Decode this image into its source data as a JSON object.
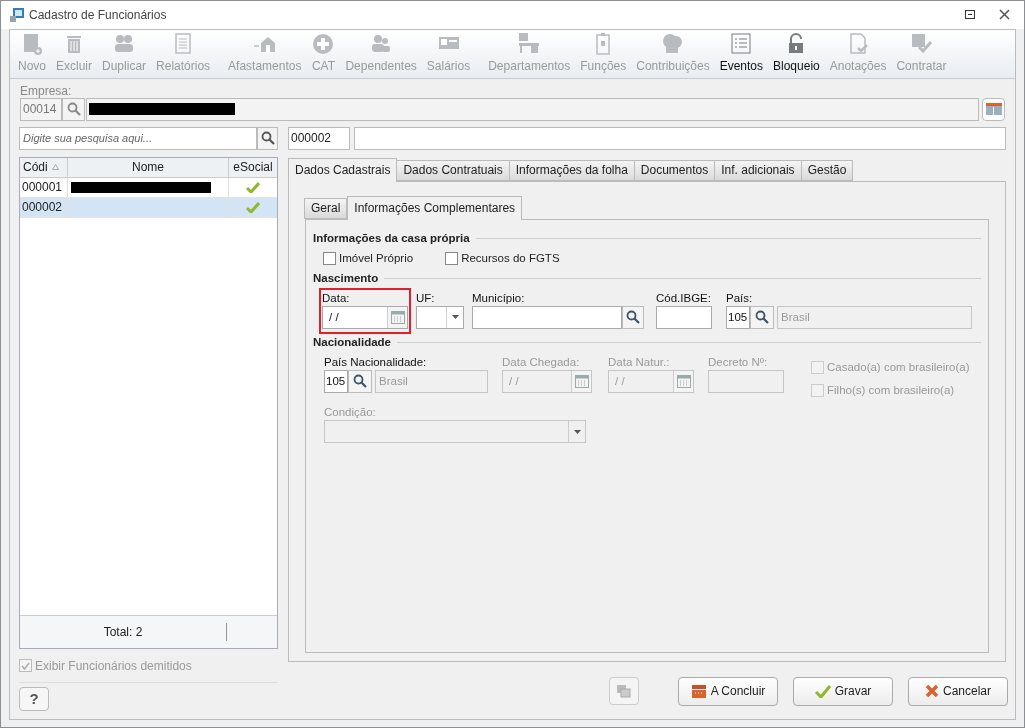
{
  "window": {
    "title": "Cadastro de Funcionários"
  },
  "toolbar": [
    {
      "label": "Novo",
      "disabled": true
    },
    {
      "label": "Excluir",
      "disabled": true
    },
    {
      "label": "Duplicar",
      "disabled": true
    },
    {
      "label": "Relatórios",
      "disabled": true
    },
    {
      "label": "Afastamentos",
      "disabled": true
    },
    {
      "label": "CAT",
      "disabled": true
    },
    {
      "label": "Dependentes",
      "disabled": true
    },
    {
      "label": "Salários",
      "disabled": true
    },
    {
      "label": "Departamentos",
      "disabled": true
    },
    {
      "label": "Funções",
      "disabled": true
    },
    {
      "label": "Contribuições",
      "disabled": true
    },
    {
      "label": "Eventos",
      "disabled": false
    },
    {
      "label": "Bloqueio",
      "disabled": false
    },
    {
      "label": "Anotações",
      "disabled": true
    },
    {
      "label": "Contratar",
      "disabled": true
    }
  ],
  "empresa": {
    "label": "Empresa:",
    "code": "00014",
    "name_redacted": true
  },
  "search": {
    "placeholder": "Digite sua pesquisa aqui..."
  },
  "grid": {
    "columns": [
      "Códi",
      "Nome",
      "eSocial"
    ],
    "rows": [
      {
        "code": "000001",
        "name_redacted": true,
        "esocial": true,
        "selected": false
      },
      {
        "code": "000002",
        "name_redacted": false,
        "esocial": true,
        "selected": true
      }
    ],
    "total": "Total: 2"
  },
  "show_dismissed": {
    "label": "Exibir Funcionários demitidos",
    "checked": true,
    "disabled": true
  },
  "help_button": "?",
  "record": {
    "code": "000002"
  },
  "tabs": [
    {
      "label": "Dados Cadastrais",
      "selected": true
    },
    {
      "label": "Dados Contratuais",
      "selected": false
    },
    {
      "label": "Informações da folha",
      "selected": false
    },
    {
      "label": "Documentos",
      "selected": false
    },
    {
      "label": "Inf. adicionais",
      "selected": false
    },
    {
      "label": "Gestão",
      "selected": false
    }
  ],
  "subtabs": [
    {
      "label": "Geral",
      "selected": false
    },
    {
      "label": "Informações Complementares",
      "selected": true
    }
  ],
  "casa_propria": {
    "title": "Informações da casa própria",
    "checkboxes": [
      {
        "label": "Imóvel Próprio",
        "checked": false
      },
      {
        "label": "Recursos do FGTS",
        "checked": false
      }
    ]
  },
  "nascimento": {
    "title": "Nascimento",
    "fields": [
      {
        "kind": "date",
        "label": "Data:",
        "value": "/ /",
        "disabled": false,
        "highlighted": true
      },
      {
        "kind": "select",
        "label": "UF:",
        "disabled": false,
        "highlighted": false
      },
      {
        "kind": "lookup",
        "label": "Município:",
        "disabled": false,
        "highlighted": false
      },
      {
        "kind": "text",
        "label": "Cód.IBGE:",
        "disabled": false,
        "highlighted": false
      },
      {
        "kind": "code_lookup",
        "label": "País:",
        "value": "105",
        "description": "Brasil",
        "disabled": false,
        "highlighted": false
      }
    ]
  },
  "nacionalidade": {
    "title": "Nacionalidade",
    "fields": [
      {
        "kind": "code_lookup",
        "label": "País Nacionalidade:",
        "value": "105",
        "description": "Brasil",
        "disabled": false,
        "highlighted": false
      },
      {
        "kind": "date",
        "label": "Data Chegada:",
        "value": "/ /",
        "disabled": true,
        "highlighted": false
      },
      {
        "kind": "date",
        "label": "Data Natur.:",
        "value": "/ /",
        "disabled": true,
        "highlighted": false
      },
      {
        "kind": "text",
        "label": "Decreto Nº:",
        "disabled": true,
        "highlighted": false
      }
    ],
    "checkboxes": [
      {
        "label": "Casado(a) com brasileiro(a)",
        "checked": false,
        "disabled": true
      },
      {
        "label": "Filho(s) com brasileiro(a)",
        "checked": false,
        "disabled": true
      }
    ],
    "condicao": {
      "kind": "select",
      "label": "Condição:",
      "disabled": true,
      "highlighted": false
    }
  },
  "buttons": [
    {
      "kind": "concluir",
      "label": "A Concluir"
    },
    {
      "kind": "gravar",
      "label": "Gravar"
    },
    {
      "kind": "cancelar",
      "label": "Cancelar"
    }
  ]
}
